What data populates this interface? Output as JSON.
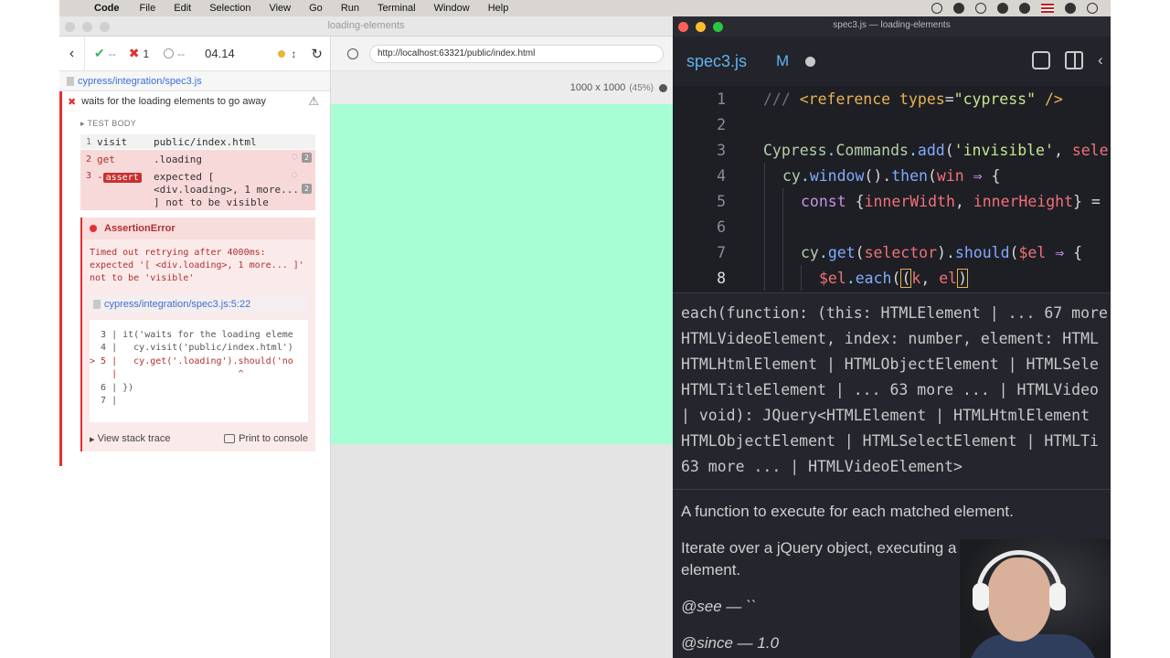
{
  "menubar": {
    "app": "Code",
    "items": [
      "File",
      "Edit",
      "Selection",
      "View",
      "Go",
      "Run",
      "Terminal",
      "Window",
      "Help"
    ]
  },
  "browser": {
    "title": "loading-elements",
    "reporter": {
      "passed": "--",
      "failed": "1",
      "pending": "--",
      "duration": "04.14",
      "spec_path": "cypress/integration/spec3.js",
      "test_title": "waits for the loading elements to go away",
      "test_body_label": "TEST BODY",
      "commands": [
        {
          "num": "1",
          "name": "visit",
          "message": "public/index.html"
        },
        {
          "num": "2",
          "name": "get",
          "message": ".loading",
          "badge": "2"
        },
        {
          "num": "3",
          "name": "assert",
          "prefix": "-",
          "message_lines": [
            "expected [",
            "<div.loading>, 1 more...",
            "] not to be visible"
          ],
          "badge": "2"
        }
      ],
      "error": {
        "title": "AssertionError",
        "message": "Timed out retrying after 4000ms:\nexpected '[ <div.loading>, 1 more... ]'\nnot to be 'visible'",
        "file": "cypress/integration/spec3.js:5:22",
        "code_frame": [
          "  3 | it('waits for the loading eleme",
          "  4 |   cy.visit('public/index.html')",
          "> 5 |   cy.get('.loading').should('no",
          "    |                      ^",
          "  6 | })",
          "  7 |"
        ],
        "stack_trace_label": "View stack trace",
        "print_label": "Print to console"
      }
    },
    "aut": {
      "url": "http://localhost:63321/public/index.html",
      "viewport": "1000 x 1000",
      "scale": "(45%)",
      "page_color": "#a7fed5"
    }
  },
  "editor": {
    "title": "spec3.js — loading-elements",
    "tab": {
      "name": "spec3.js",
      "modified": "M"
    },
    "lines": [
      "1",
      "2",
      "3",
      "4",
      "5",
      "6",
      "7",
      "8"
    ],
    "hover": {
      "signature_lines": [
        "each(function: (this: HTMLElement | ... 67 more",
        "HTMLVideoElement, index: number, element: HTML",
        "HTMLHtmlElement | HTMLObjectElement | HTMLSele",
        "HTMLTitleElement | ... 63 more ... | HTMLVideo",
        "| void): JQuery<HTMLElement | HTMLHtmlElement",
        "HTMLObjectElement | HTMLSelectElement | HTMLTi",
        "63 more ... | HTMLVideoElement>"
      ],
      "doc_summary": "A function to execute for each matched element.",
      "doc_body": "Iterate over a jQuery object, executing a function for e element.",
      "see": "@see — ``",
      "since": "@since — 1.0"
    }
  }
}
